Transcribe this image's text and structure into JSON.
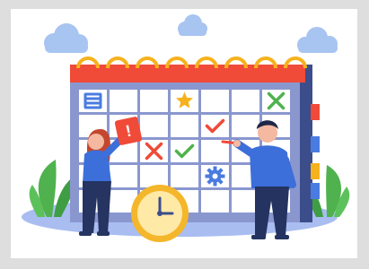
{
  "scene": {
    "alt": "",
    "palette": {
      "backdrop": "#dedede",
      "card": "#ffffff",
      "ground": "#a9bdf1",
      "calendar_header": "#f04a38",
      "calendar_rings": "#f6b21c",
      "calendar_body": "#8a97cf",
      "calendar_cells": "#ffffff",
      "calendar_spine": "#3c4d8c",
      "tab_colors": [
        "#f04a38",
        "#4a7be0",
        "#f6b21c",
        "#4a7be0"
      ],
      "cloud": "#a8c4f1",
      "leaves": "#4fb24e",
      "clock_face": "#ffe9a6",
      "clock_rim": "#f4b62a",
      "woman_hair": "#c4462e",
      "woman_top": "#3c6fd9",
      "woman_pants": "#253460",
      "man_hair": "#1e2748",
      "man_top": "#3c6fd9",
      "man_pants": "#243360",
      "skin": "#f4b9a0",
      "alert_card": "#f04a38",
      "pencil": "#f04a38"
    },
    "cell_icons": [
      {
        "row": 0,
        "col": 0,
        "icon": "list-icon"
      },
      {
        "row": 0,
        "col": 3,
        "icon": "star-icon"
      },
      {
        "row": 0,
        "col": 6,
        "icon": "cross-icon"
      },
      {
        "row": 1,
        "col": 4,
        "icon": "check-icon"
      },
      {
        "row": 2,
        "col": 2,
        "icon": "cross-icon"
      },
      {
        "row": 2,
        "col": 3,
        "icon": "check-icon"
      },
      {
        "row": 3,
        "col": 4,
        "icon": "gear-icon"
      }
    ],
    "alert_glyph": "!"
  }
}
